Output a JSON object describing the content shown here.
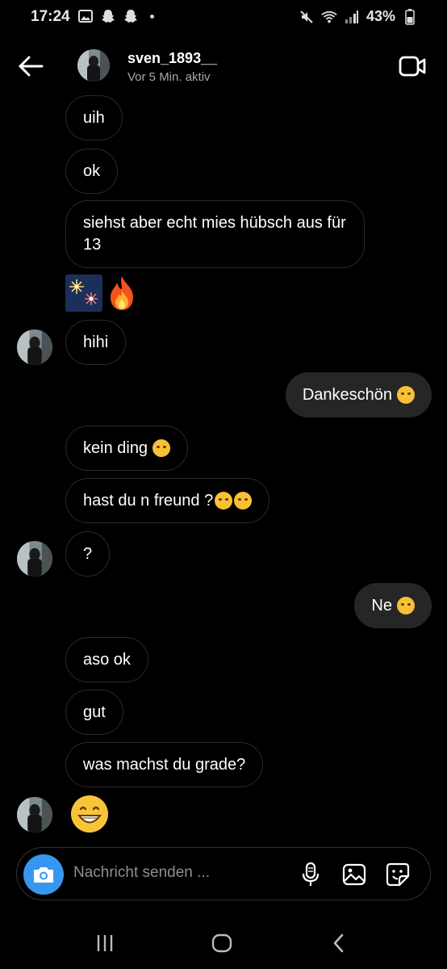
{
  "status_bar": {
    "time": "17:24",
    "battery_pct": "43%",
    "left_icons": [
      "gallery-icon",
      "snapchat-icon",
      "snapchat-icon",
      "dot-icon"
    ],
    "right_icons": [
      "mute-icon",
      "wifi-icon",
      "signal-icon",
      "battery-icon"
    ]
  },
  "header": {
    "username": "sven_1893__",
    "status": "Vor 5 Min. aktiv",
    "back_icon": "arrow-left-icon",
    "video_icon": "video-call-icon"
  },
  "messages": [
    {
      "dir": "in",
      "text": "uih"
    },
    {
      "dir": "in",
      "text": "ok"
    },
    {
      "dir": "in",
      "text": "siehst aber echt mies hübsch aus für 13"
    },
    {
      "dir": "in",
      "stickers": [
        "fireworks-emoji",
        "fire-emoji"
      ]
    },
    {
      "dir": "in",
      "text": "hihi",
      "avatar": true
    },
    {
      "dir": "out",
      "text": "Dankeschön",
      "emoji": "smiling-face-emoji"
    },
    {
      "dir": "in",
      "text": "kein ding",
      "emoji": "smiling-face-emoji"
    },
    {
      "dir": "in",
      "text": "hast du n freund ?",
      "emoji": [
        "yawning-face-emoji",
        "pleading-face-emoji"
      ]
    },
    {
      "dir": "in",
      "text": "?",
      "avatar": true
    },
    {
      "dir": "out",
      "text": "Ne",
      "emoji": "upside-down-face-emoji"
    },
    {
      "dir": "in",
      "text": "aso ok"
    },
    {
      "dir": "in",
      "text": "gut"
    },
    {
      "dir": "in",
      "text": "was machst du grade?"
    },
    {
      "dir": "in",
      "big_emoji": "grinning-face-emoji",
      "avatar": true
    }
  ],
  "composer": {
    "placeholder": "Nachricht senden ...",
    "value": "",
    "icons": [
      "camera-icon",
      "microphone-icon",
      "gallery-icon",
      "sticker-icon"
    ]
  },
  "colors": {
    "background": "#000000",
    "outgoing_bubble": "#262626",
    "incoming_border": "#2a2a2a",
    "camera_button": "#3797f0",
    "secondary_text": "#a8a8a8"
  },
  "nav": {
    "icons": [
      "recent-apps-icon",
      "home-icon",
      "back-icon"
    ]
  }
}
